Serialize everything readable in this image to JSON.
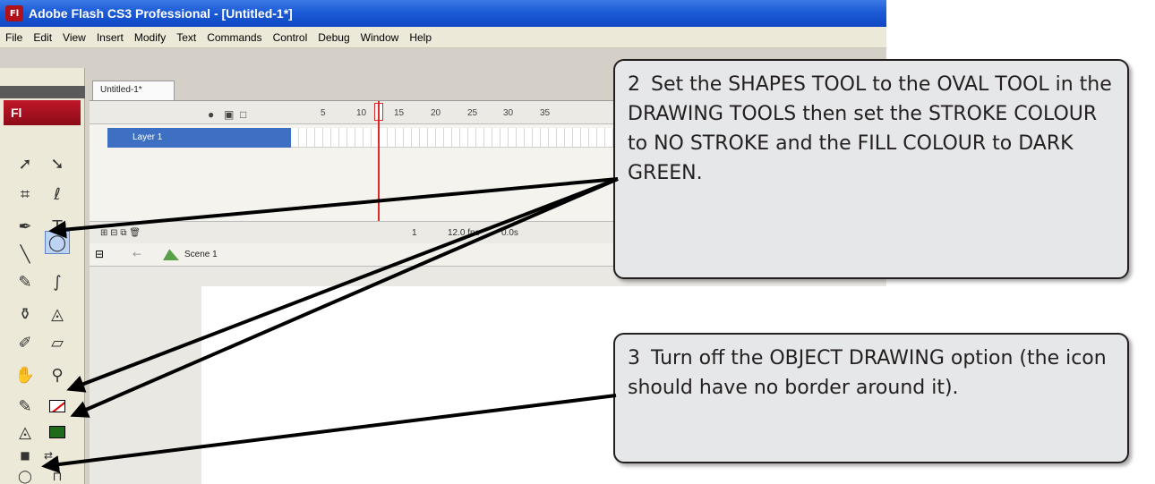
{
  "window": {
    "title": "Adobe Flash CS3 Professional - [Untitled-1*]",
    "app_icon": "Fl"
  },
  "menu": {
    "items": [
      "File",
      "Edit",
      "View",
      "Insert",
      "Modify",
      "Text",
      "Commands",
      "Control",
      "Debug",
      "Window",
      "Help"
    ]
  },
  "tools": {
    "logo": "Fl",
    "items": [
      {
        "name": "selection-tool-icon",
        "glyph": "➚"
      },
      {
        "name": "subselection-tool-icon",
        "glyph": "➘"
      },
      {
        "name": "free-transform-tool-icon",
        "glyph": "⌗"
      },
      {
        "name": "lasso-tool-icon",
        "glyph": "ℓ"
      },
      {
        "name": "pen-tool-icon",
        "glyph": "✒"
      },
      {
        "name": "text-tool-icon",
        "glyph": "T"
      },
      {
        "name": "line-tool-icon",
        "glyph": "╲"
      },
      {
        "name": "oval-tool-icon",
        "glyph": "◯"
      },
      {
        "name": "pencil-tool-icon",
        "glyph": "✎"
      },
      {
        "name": "brush-tool-icon",
        "glyph": "∫"
      },
      {
        "name": "ink-bottle-tool-icon",
        "glyph": "⚱"
      },
      {
        "name": "paint-bucket-tool-icon",
        "glyph": "◬"
      },
      {
        "name": "eyedropper-tool-icon",
        "glyph": "✐"
      },
      {
        "name": "eraser-tool-icon",
        "glyph": "▱"
      },
      {
        "name": "hand-tool-icon",
        "glyph": "✋"
      },
      {
        "name": "zoom-tool-icon",
        "glyph": "⚲"
      }
    ],
    "stroke_color": "none",
    "fill_color": "#1f6b1a",
    "object_drawing": "off"
  },
  "document": {
    "tab_label": "Untitled-1*",
    "layer_name": "Layer 1",
    "frame_numbers": [
      "5",
      "10",
      "15",
      "20",
      "25",
      "30",
      "35"
    ],
    "status": {
      "frame": "1",
      "fps": "12.0 fps",
      "time": "0.0s"
    },
    "scene_label": "Scene 1"
  },
  "callouts": [
    {
      "number": "2",
      "text": "Set the SHAPES TOOL to the OVAL TOOL in the DRAWING TOOLS then set the STROKE COLOUR to NO STROKE and the FILL COLOUR to DARK GREEN."
    },
    {
      "number": "3",
      "text": "Turn off the OBJECT DRAWING option (the icon should have no border around it)."
    }
  ]
}
